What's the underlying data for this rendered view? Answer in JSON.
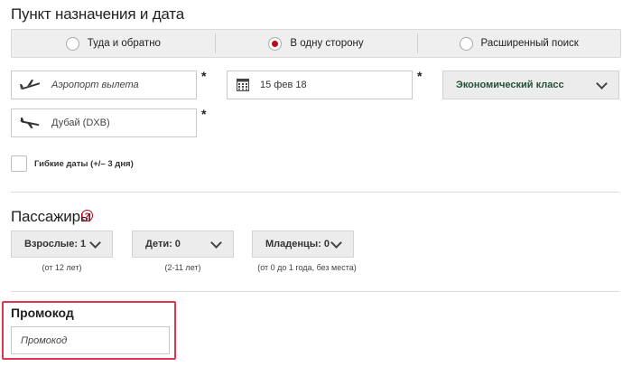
{
  "destination": {
    "title": "Пункт назначения и дата",
    "trip_types": [
      {
        "label": "Туда и обратно",
        "selected": false
      },
      {
        "label": "В одну сторону",
        "selected": true
      },
      {
        "label": "Расширенный поиск",
        "selected": false
      }
    ],
    "origin_placeholder": "Аэропорт вылета",
    "destination_value": "Дубай (DXB)",
    "date_value": "15 фев 18",
    "class_value": "Экономический класс",
    "required_mark": "*",
    "flexible_dates_label": "Гибкие даты (+/– 3 дня)"
  },
  "passengers": {
    "title": "Пассажиры",
    "help": "?",
    "items": [
      {
        "label": "Взрослые: 1",
        "note": "(от 12 лет)"
      },
      {
        "label": "Дети: 0",
        "note": "(2-11 лет)"
      },
      {
        "label": "Младенцы: 0",
        "note": "(от 0 до 1 года, без места)"
      }
    ]
  },
  "promo": {
    "title": "Промокод",
    "placeholder": "Промокод"
  },
  "colors": {
    "accent": "#c5001a",
    "class_text": "#245138",
    "highlight": "#e1354f"
  }
}
